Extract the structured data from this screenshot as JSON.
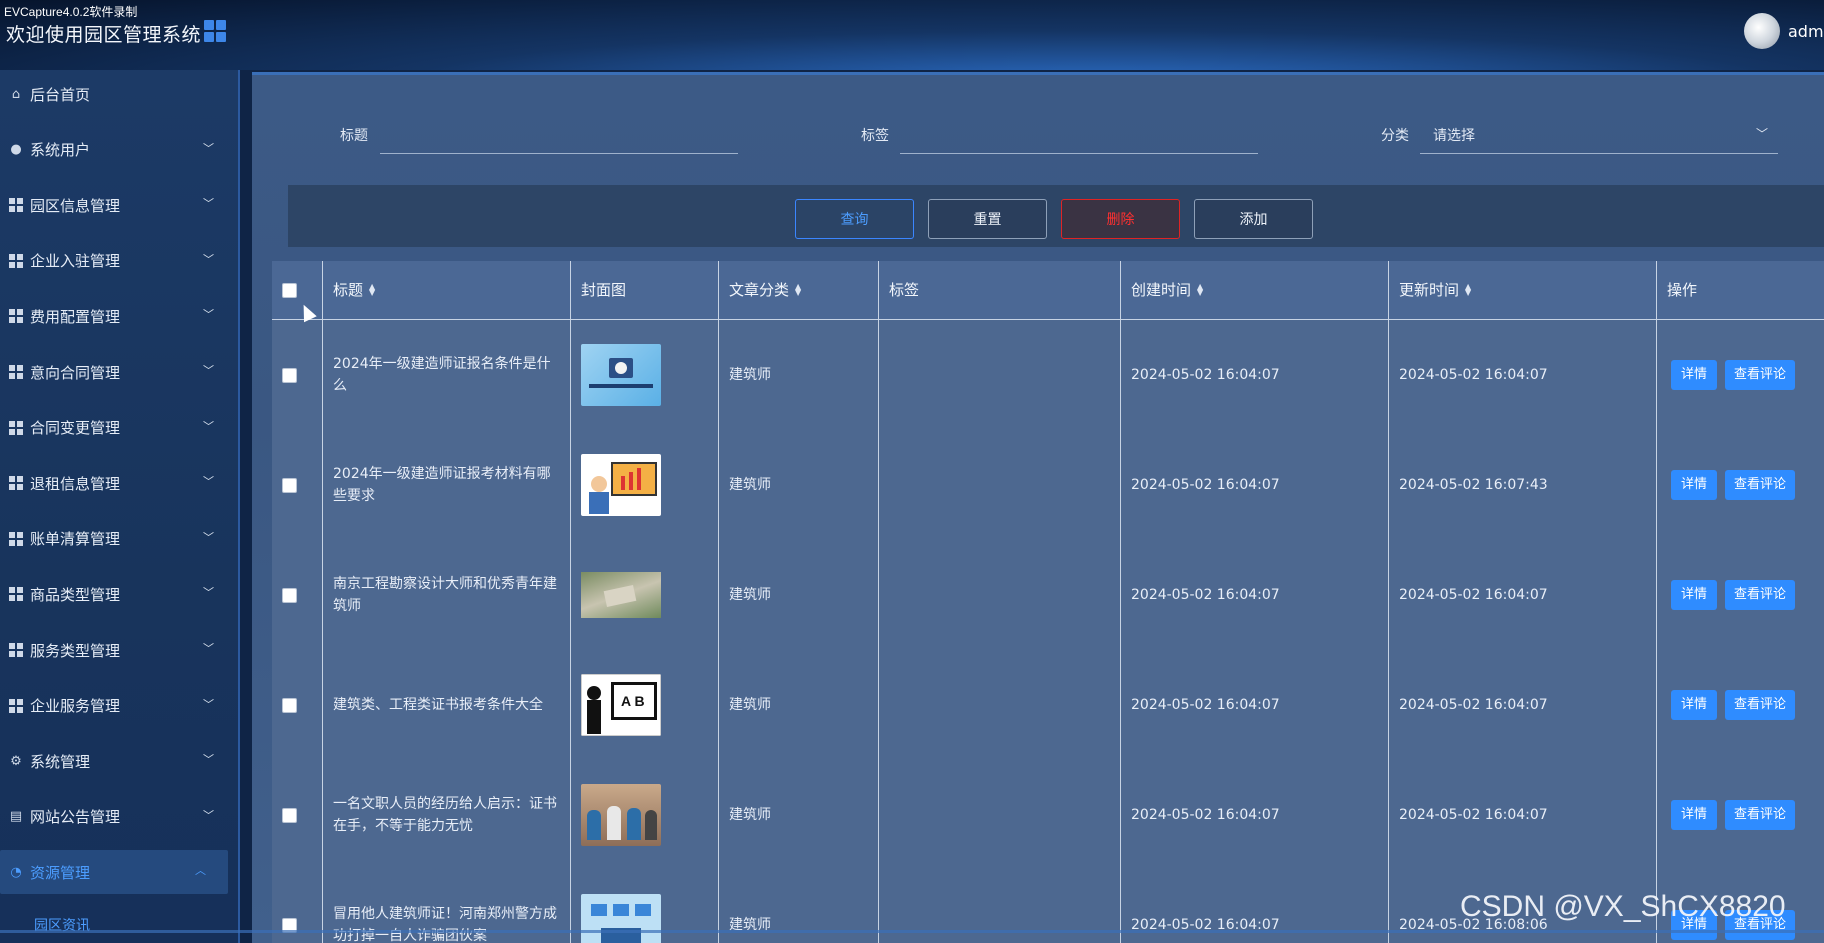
{
  "watermark_top": "EVCapture4.0.2软件录制",
  "header": {
    "title": "欢迎使用园区管理系统",
    "user": "admin"
  },
  "sidebar": {
    "items": [
      {
        "label": "后台首页",
        "icon": "home-icon"
      },
      {
        "label": "系统用户",
        "icon": "user-icon"
      },
      {
        "label": "园区信息管理",
        "icon": "grid-icon"
      },
      {
        "label": "企业入驻管理",
        "icon": "grid-icon"
      },
      {
        "label": "费用配置管理",
        "icon": "grid-icon"
      },
      {
        "label": "意向合同管理",
        "icon": "grid-icon"
      },
      {
        "label": "合同变更管理",
        "icon": "grid-icon"
      },
      {
        "label": "退租信息管理",
        "icon": "grid-icon"
      },
      {
        "label": "账单清算管理",
        "icon": "grid-icon"
      },
      {
        "label": "商品类型管理",
        "icon": "grid-icon"
      },
      {
        "label": "服务类型管理",
        "icon": "grid-icon"
      },
      {
        "label": "企业服务管理",
        "icon": "grid-icon"
      },
      {
        "label": "系统管理",
        "icon": "gear-icon"
      },
      {
        "label": "网站公告管理",
        "icon": "notice-icon"
      },
      {
        "label": "资源管理",
        "icon": "pie-icon"
      }
    ],
    "sub_item": "园区资讯"
  },
  "filters": {
    "title_label": "标题",
    "tag_label": "标签",
    "category_label": "分类",
    "category_placeholder": "请选择"
  },
  "buttons": {
    "query": "查询",
    "reset": "重置",
    "delete": "删除",
    "add": "添加"
  },
  "table": {
    "headers": [
      "标题",
      "封面图",
      "文章分类",
      "标签",
      "创建时间",
      "更新时间",
      "操作"
    ],
    "rows": [
      {
        "title": "2024年一级建造师证报名条件是什么",
        "category": "建筑师",
        "tag": "",
        "created": "2024-05-02 16:04:07",
        "updated": "2024-05-02 16:04:07",
        "cover": "cover-tech"
      },
      {
        "title": "2024年一级建造师证报考材料有哪些要求",
        "category": "建筑师",
        "tag": "",
        "created": "2024-05-02 16:04:07",
        "updated": "2024-05-02 16:07:43",
        "cover": "cover-presenter"
      },
      {
        "title": "南京工程勘察设计大师和优秀青年建筑师",
        "category": "建筑师",
        "tag": "",
        "created": "2024-05-02 16:04:07",
        "updated": "2024-05-02 16:04:07",
        "cover": "cover-aerial"
      },
      {
        "title": "建筑类、工程类证书报考条件大全",
        "category": "建筑师",
        "tag": "",
        "created": "2024-05-02 16:04:07",
        "updated": "2024-05-02 16:04:07",
        "cover": "cover-teacher"
      },
      {
        "title": "一名文职人员的经历给人启示：证书在手，不等于能力无忧",
        "category": "建筑师",
        "tag": "",
        "created": "2024-05-02 16:04:07",
        "updated": "2024-05-02 16:04:07",
        "cover": "cover-people"
      },
      {
        "title": "冒用他人建筑师证！河南郑州警方成功打掉一自人诈骗团伙案",
        "category": "建筑师",
        "tag": "",
        "created": "2024-05-02 16:04:07",
        "updated": "2024-05-02 16:08:06",
        "cover": "cover-screens"
      }
    ],
    "op_detail": "详情",
    "op_comment": "查看评论"
  },
  "watermark_bottom": "CSDN @VX_ShCX8820",
  "colors": {
    "accent": "#2f8cff",
    "danger": "#ff3030",
    "panel": "#3c5a86"
  }
}
